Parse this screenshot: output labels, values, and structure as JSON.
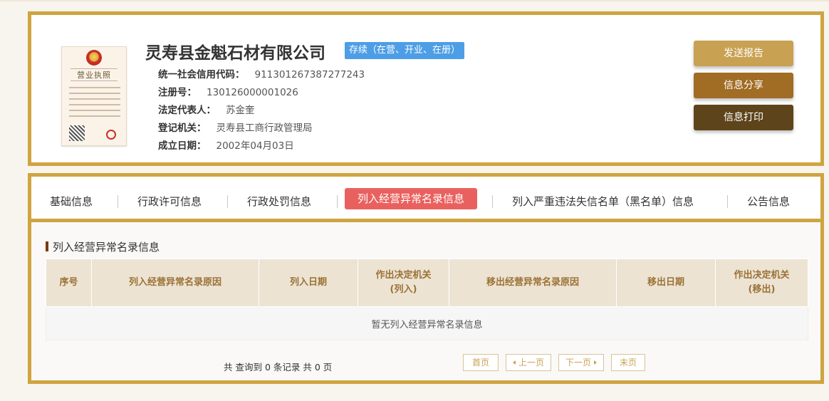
{
  "license_image": {
    "title": "营业执照"
  },
  "company": {
    "name": "灵寿县金魁石材有限公司",
    "status": "存续（在营、开业、在册）",
    "fields": [
      {
        "label": "统一社会信用代码：",
        "value": "911301267387277243"
      },
      {
        "label": "注册号：",
        "value": "130126000001026"
      },
      {
        "label": "法定代表人：",
        "value": "苏金奎"
      },
      {
        "label": "登记机关：",
        "value": "灵寿县工商行政管理局"
      },
      {
        "label": "成立日期：",
        "value": "2002年04月03日"
      }
    ]
  },
  "actions": {
    "send_report": "发送报告",
    "share": "信息分享",
    "print": "信息打印"
  },
  "tabs": [
    {
      "label": "基础信息"
    },
    {
      "label": "行政许可信息"
    },
    {
      "label": "行政处罚信息"
    },
    {
      "label": "列入经营异常名录信息",
      "active": true
    },
    {
      "label": "列入严重违法失信名单（黑名单）信息"
    },
    {
      "label": "公告信息"
    }
  ],
  "section": {
    "title": "列入经营异常名录信息"
  },
  "table": {
    "headers": [
      "序号",
      "列入经营异常名录原因",
      "列入日期",
      "作出决定机关\n(列入)",
      "移出经营异常名录原因",
      "移出日期",
      "作出决定机关\n(移出)"
    ],
    "empty_text": "暂无列入经营异常名录信息"
  },
  "pager": {
    "summary": "共 查询到 0 条记录 共 0 页",
    "first": "首页",
    "prev": "上一页",
    "next": "下一页",
    "last": "末页"
  },
  "colors": {
    "frame_gold": "#cfa441",
    "badge_blue": "#4d9ee6",
    "tab_active_red": "#e9615f",
    "btn_report": "#c9a153",
    "btn_share": "#a16c23",
    "btn_print": "#5e441b",
    "table_header_bg": "#ece3d3",
    "table_header_text": "#9b7134"
  }
}
